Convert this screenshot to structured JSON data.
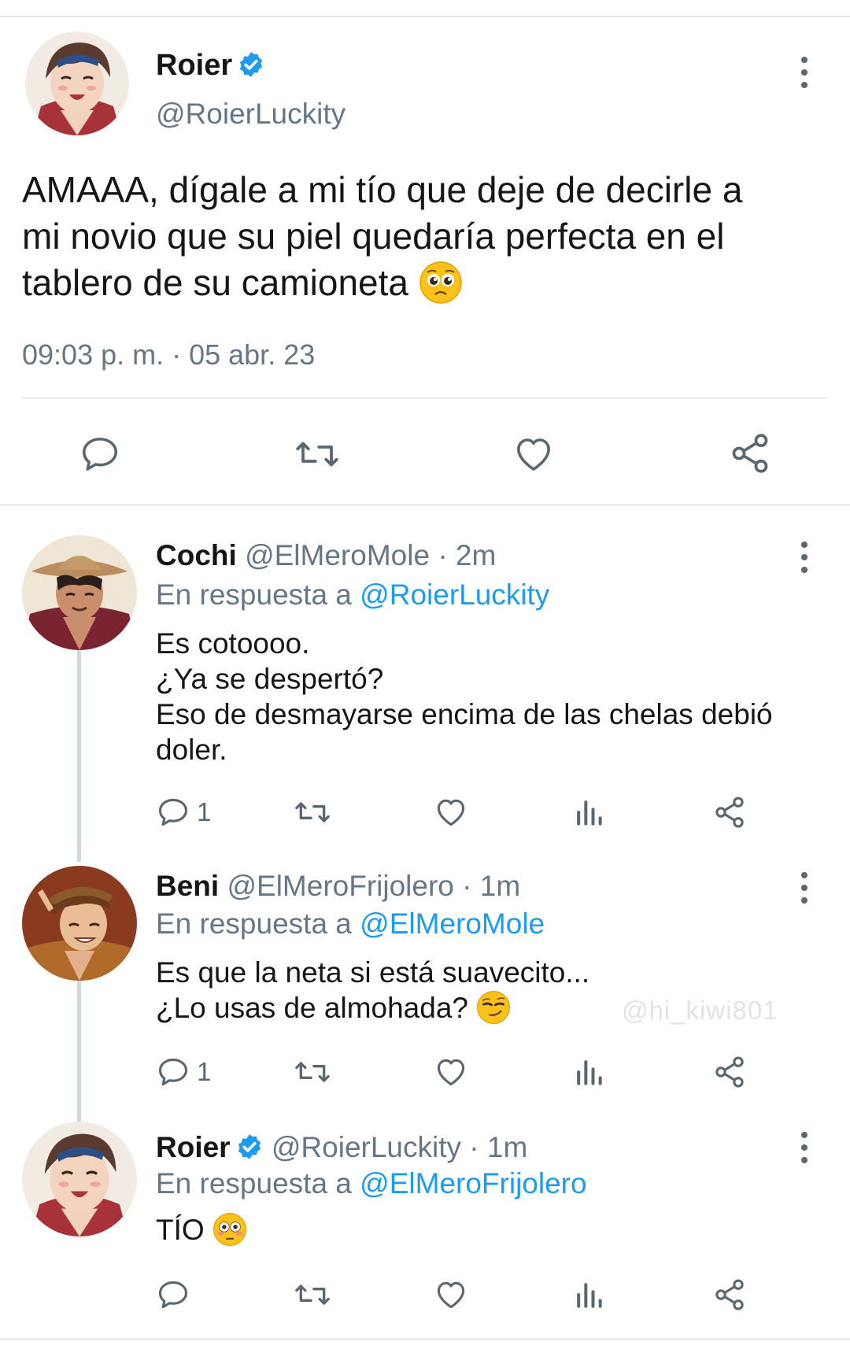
{
  "main_tweet": {
    "author_name": "Roier",
    "author_handle": "@RoierLuckity",
    "text_lines": [
      "AMAAA, dígale a mi tío que deje de decirle a",
      "mi novio que su piel quedaría perfecta en el",
      "tablero de su camioneta"
    ],
    "text_emoji": "pleading-face-emoji",
    "timestamp": "09:03 p. m. · 05 abr. 23",
    "actions": [
      "reply-icon",
      "retweet-icon",
      "like-icon",
      "share-icon"
    ]
  },
  "replies": [
    {
      "author_name": "Cochi",
      "author_handle": "@ElMeroMole",
      "time": "· 2m",
      "in_reply_prefix": "En respuesta a",
      "in_reply_to": "@RoierLuckity",
      "body_lines": [
        "Es cotoooo.",
        "¿Ya se despertó?",
        "Eso de desmayarse encima de las chelas debió",
        "doler."
      ],
      "reply_count": "1"
    },
    {
      "author_name": "Beni",
      "author_handle": "@ElMeroFrijolero",
      "time": "· 1m",
      "in_reply_prefix": "En respuesta a",
      "in_reply_to": "@ElMeroMole",
      "body_lines": [
        "Es que la neta si está suavecito...",
        "¿Lo usas de almohada?"
      ],
      "body_emoji": "smirking-face-emoji",
      "reply_count": "1"
    },
    {
      "author_name": "Roier",
      "author_handle": "@RoierLuckity",
      "time": "· 1m",
      "in_reply_prefix": "En respuesta a",
      "in_reply_to": "@ElMeroFrijolero",
      "body_lines": [
        "TÍO"
      ],
      "body_emoji": "flushed-face-emoji",
      "reply_count": ""
    }
  ],
  "watermark": "@hi_kiwi801",
  "colors": {
    "verified_blue": "#1d9bf0",
    "mention_blue": "#1d9bf0",
    "secondary_text": "#657786",
    "icon_gray": "#5b6770",
    "thread_line": "#cfd9de"
  }
}
